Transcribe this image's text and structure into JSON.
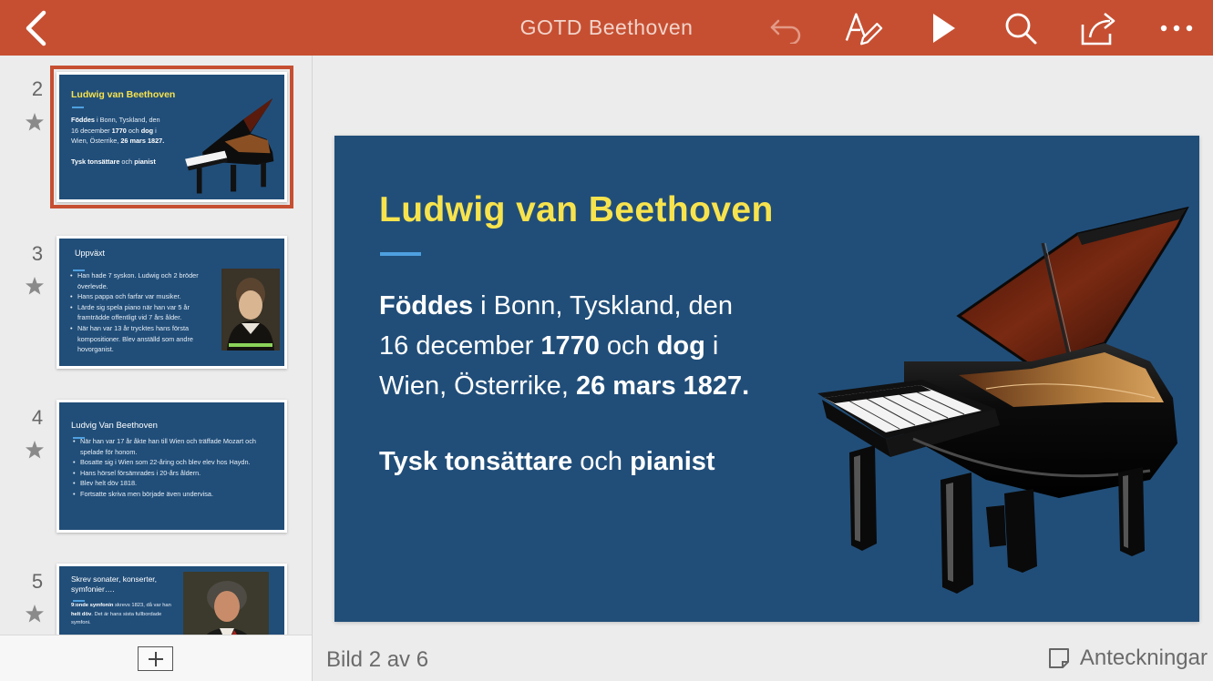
{
  "app": {
    "title": "GOTD Beethoven",
    "accent": "#c64f32"
  },
  "toolbar": {
    "icons": [
      "back-icon",
      "undo-icon",
      "edit-pen-icon",
      "play-icon",
      "search-icon",
      "share-icon",
      "more-icon"
    ]
  },
  "slides": [
    {
      "number": "2",
      "title": "Ludwig van Beethoven",
      "line1_b1": "Föddes",
      "line1_t1": " i Bonn, Tyskland, den",
      "line2_t1": "16 december ",
      "line2_b1": "1770",
      "line2_t2": " och ",
      "line2_b2": "dog",
      "line2_t3": " i",
      "line3_t1": "Wien, Österrike, ",
      "line3_b1": "26 mars 1827.",
      "line4_b1": "Tysk tonsättare",
      "line4_t1": " och ",
      "line4_b2": "pianist",
      "image": "grand-piano"
    },
    {
      "number": "3",
      "title": "Uppväxt",
      "bullets": [
        "Han hade 7 syskon. Ludwig och 2 bröder överlevde.",
        "Hans pappa och farfar var musiker.",
        "Lärde sig spela piano när han var 5 år framträdde offentligt vid 7 års ålder.",
        "När han var 13 år trycktes hans första kompositioner. Blev anställd som andre hovorganist."
      ],
      "image": "young-beethoven-portrait"
    },
    {
      "number": "4",
      "title": "Ludvig Van Beethoven",
      "bullets": [
        "När han var 17 år åkte han till Wien och träffade Mozart och spelade för honom.",
        "Bosatte sig i Wien som 22-åring och blev elev hos Haydn.",
        "Hans hörsel försämrades i 20-års åldern.",
        "Blev helt döv 1818.",
        "Fortsatte skriva men började även undervisa."
      ]
    },
    {
      "number": "5",
      "title": "Skrev sonater, konserter, symfonier….",
      "body_b1": "9:onde symfonin",
      "body_t1": " skrevs 1823, då var han ",
      "body_b2": "helt döv",
      "body_t2": ". Det är hans sista fullbordade symfoni.",
      "image": "beethoven-portrait"
    }
  ],
  "status": {
    "slide_counter": "Bild 2 av 6",
    "notes_label": "Anteckningar"
  }
}
